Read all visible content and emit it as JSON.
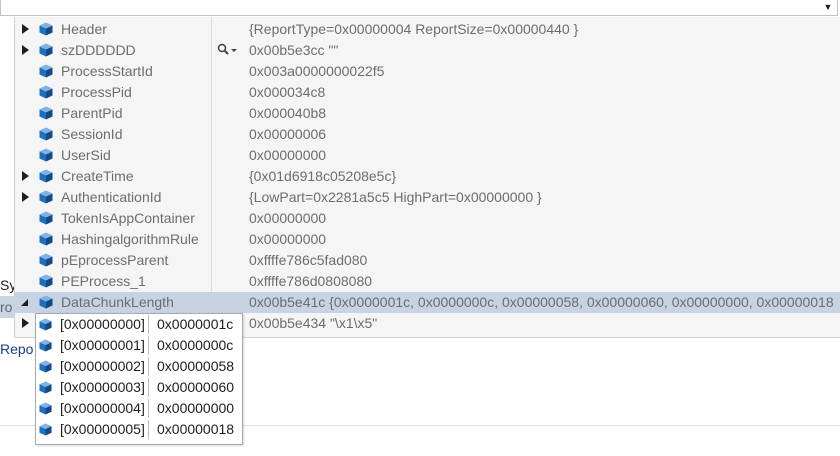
{
  "background": {
    "fragment_sy": "Sy",
    "fragment_ro": "ro",
    "fragment_repo": "Repo"
  },
  "watch_rows": [
    {
      "name": "Header",
      "value": "{ReportType=0x00000004 ReportSize=0x00000440 }",
      "expandable": true,
      "expanded": false,
      "selected": false,
      "magnifier": false
    },
    {
      "name": "szDDDDDD",
      "value": "0x00b5e3cc \"\"",
      "expandable": true,
      "expanded": false,
      "selected": false,
      "magnifier": true
    },
    {
      "name": "ProcessStartId",
      "value": "0x003a0000000022f5",
      "expandable": false,
      "expanded": false,
      "selected": false,
      "magnifier": false
    },
    {
      "name": "ProcessPid",
      "value": "0x000034c8",
      "expandable": false,
      "expanded": false,
      "selected": false,
      "magnifier": false
    },
    {
      "name": "ParentPid",
      "value": "0x000040b8",
      "expandable": false,
      "expanded": false,
      "selected": false,
      "magnifier": false
    },
    {
      "name": "SessionId",
      "value": "0x00000006",
      "expandable": false,
      "expanded": false,
      "selected": false,
      "magnifier": false
    },
    {
      "name": "UserSid",
      "value": "0x00000000",
      "expandable": false,
      "expanded": false,
      "selected": false,
      "magnifier": false
    },
    {
      "name": "CreateTime",
      "value": "{0x01d6918c05208e5c}",
      "expandable": true,
      "expanded": false,
      "selected": false,
      "magnifier": false
    },
    {
      "name": "AuthenticationId",
      "value": "{LowPart=0x2281a5c5 HighPart=0x00000000 }",
      "expandable": true,
      "expanded": false,
      "selected": false,
      "magnifier": false
    },
    {
      "name": "TokenIsAppContainer",
      "value": "0x00000000",
      "expandable": false,
      "expanded": false,
      "selected": false,
      "magnifier": false
    },
    {
      "name": "HashingalgorithmRule",
      "value": "0x00000000",
      "expandable": false,
      "expanded": false,
      "selected": false,
      "magnifier": false
    },
    {
      "name": "pEprocessParent",
      "value": "0xffffe786c5fad080",
      "expandable": false,
      "expanded": false,
      "selected": false,
      "magnifier": false
    },
    {
      "name": "PEProcess_1",
      "value": "0xffffe786d0808080",
      "expandable": false,
      "expanded": false,
      "selected": false,
      "magnifier": false
    },
    {
      "name": "DataChunkLength",
      "value": "0x00b5e41c {0x0000001c, 0x0000000c, 0x00000058, 0x00000060, 0x00000000, 0x00000018",
      "expandable": true,
      "expanded": true,
      "selected": true,
      "magnifier": false
    },
    {
      "name": "",
      "value": "0x00b5e434 \"\\x1\\x5\"",
      "expandable": true,
      "expanded": false,
      "selected": false,
      "magnifier": false
    }
  ],
  "popup_rows": [
    {
      "index": "[0x00000000]",
      "value": "0x0000001c"
    },
    {
      "index": "[0x00000001]",
      "value": "0x0000000c"
    },
    {
      "index": "[0x00000002]",
      "value": "0x00000058"
    },
    {
      "index": "[0x00000003]",
      "value": "0x00000060"
    },
    {
      "index": "[0x00000004]",
      "value": "0x00000000"
    },
    {
      "index": "[0x00000005]",
      "value": "0x00000018"
    }
  ],
  "colors": {
    "panel_bg": "#f5f5f5",
    "selected_row": "#c7d3e2",
    "cube_icon": "#1f6fbf",
    "text_gray": "#6d6d6d"
  },
  "icons": {
    "combo_arrow": "chevron-down-icon",
    "expander": "expander-triangle-icon",
    "field": "field-cube-icon",
    "magnifier": "magnifier-icon"
  }
}
